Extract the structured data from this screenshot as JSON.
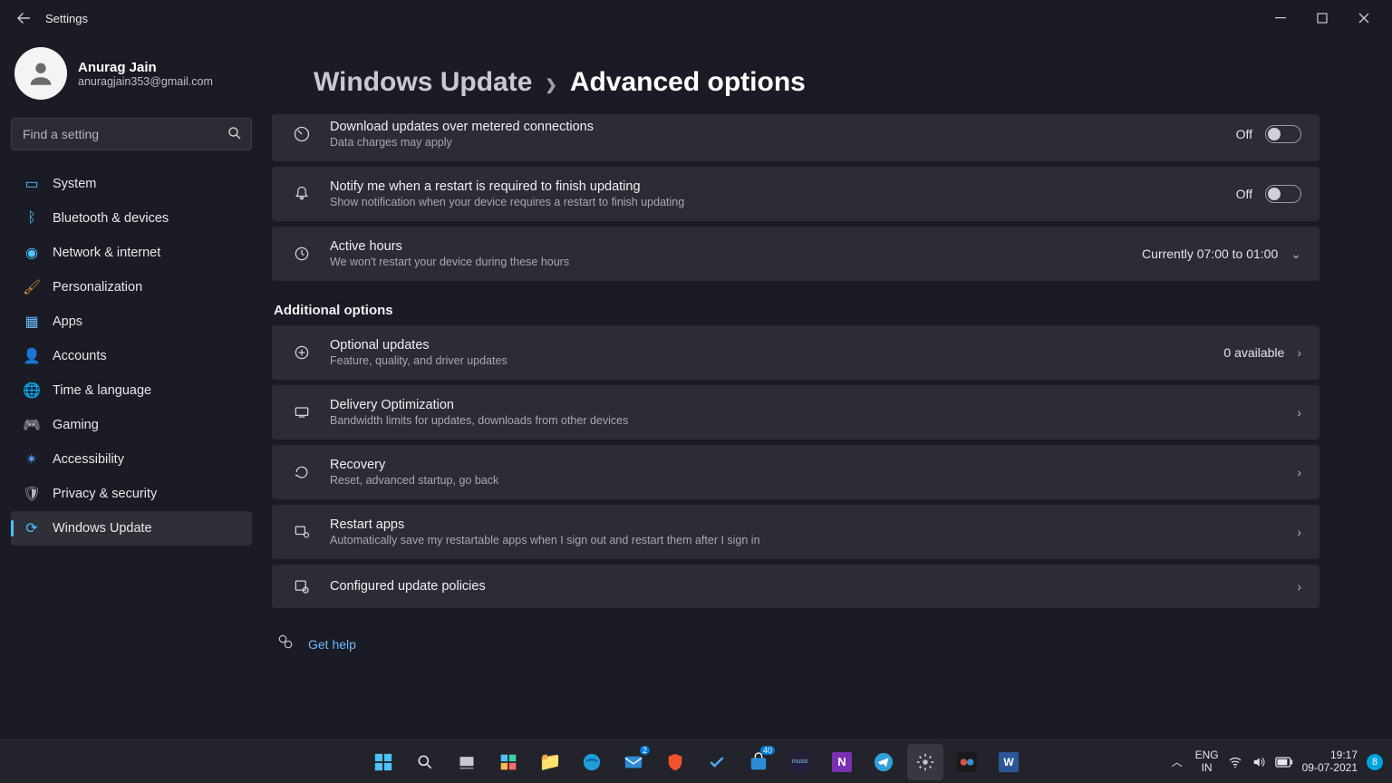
{
  "app": {
    "title": "Settings"
  },
  "user": {
    "name": "Anurag Jain",
    "email": "anuragjain353@gmail.com"
  },
  "search": {
    "placeholder": "Find a setting"
  },
  "nav": [
    {
      "label": "System"
    },
    {
      "label": "Bluetooth & devices"
    },
    {
      "label": "Network & internet"
    },
    {
      "label": "Personalization"
    },
    {
      "label": "Apps"
    },
    {
      "label": "Accounts"
    },
    {
      "label": "Time & language"
    },
    {
      "label": "Gaming"
    },
    {
      "label": "Accessibility"
    },
    {
      "label": "Privacy & security"
    },
    {
      "label": "Windows Update"
    }
  ],
  "breadcrumb": {
    "parent": "Windows Update",
    "current": "Advanced options"
  },
  "toggles": {
    "metered": {
      "title": "Download updates over metered connections",
      "sub": "Data charges may apply",
      "state": "Off"
    },
    "notify": {
      "title": "Notify me when a restart is required to finish updating",
      "sub": "Show notification when your device requires a restart to finish updating",
      "state": "Off"
    }
  },
  "active_hours": {
    "title": "Active hours",
    "sub": "We won't restart your device during these hours",
    "value": "Currently 07:00 to 01:00"
  },
  "section_additional": "Additional options",
  "links": {
    "optional": {
      "title": "Optional updates",
      "sub": "Feature, quality, and driver updates",
      "value": "0 available"
    },
    "delivery": {
      "title": "Delivery Optimization",
      "sub": "Bandwidth limits for updates, downloads from other devices"
    },
    "recovery": {
      "title": "Recovery",
      "sub": "Reset, advanced startup, go back"
    },
    "restart": {
      "title": "Restart apps",
      "sub": "Automatically save my restartable apps when I sign out and restart them after I sign in"
    },
    "policies": {
      "title": "Configured update policies"
    }
  },
  "help": {
    "label": "Get help"
  },
  "taskbar": {
    "lang_top": "ENG",
    "lang_bottom": "IN",
    "time": "19:17",
    "date": "09-07-2021",
    "notif_count": "8",
    "badges": {
      "mail": "2",
      "store": "40"
    }
  }
}
